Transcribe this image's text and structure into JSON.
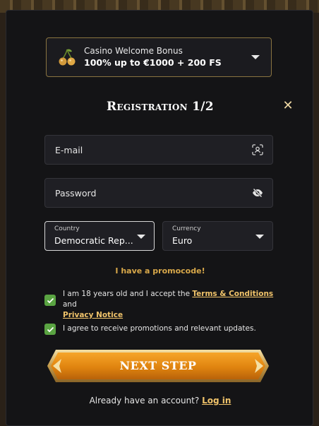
{
  "bonus": {
    "title": "Casino Welcome Bonus",
    "subtitle": "100% up to €1000 + 200 FS"
  },
  "form": {
    "title": "Registration 1/2",
    "email_placeholder": "E-mail",
    "password_placeholder": "Password",
    "country_label": "Country",
    "country_value": "Democratic Rep...",
    "currency_label": "Currency",
    "currency_value": "Euro",
    "promo_link": "I have a promocode!",
    "terms_prefix": "I am 18 years old and I accept the",
    "terms_link": "Terms & Conditions",
    "terms_and": "and",
    "privacy_link": "Privacy Notice",
    "promotions_text": "I agree to receive promotions and relevant updates.",
    "next_label": "NEXT STEP",
    "account_text": "Already have an account?",
    "login_link": "Log in"
  },
  "colors": {
    "accent_gold": "#d8a84a",
    "button_orange": "#e0840f",
    "checkbox_green": "#5aa442",
    "modal_bg": "#141416"
  },
  "icons": {
    "bonus": "cherry-icon",
    "close": "close-icon",
    "email": "face-scan-icon",
    "password": "eye-off-icon"
  }
}
